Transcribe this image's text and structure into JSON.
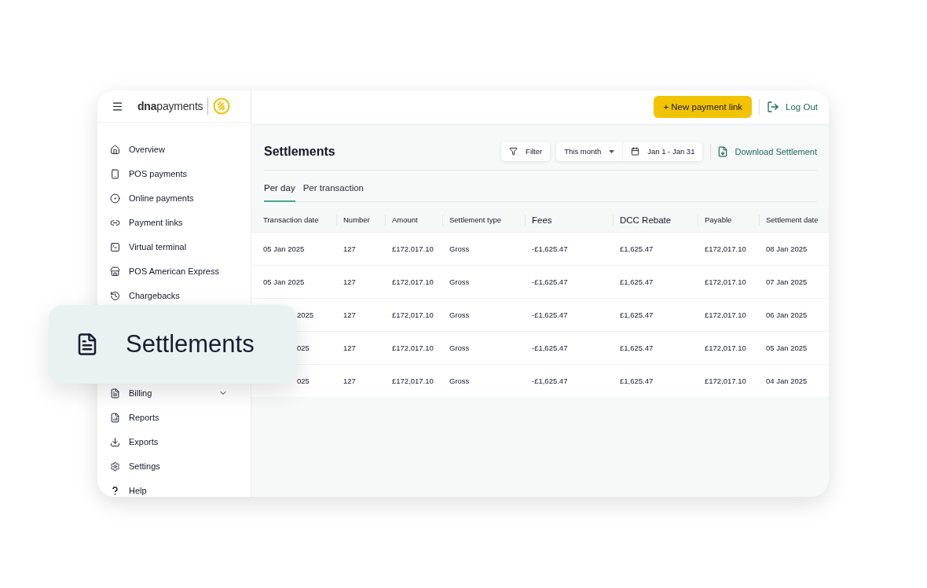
{
  "brand": {
    "name_bold": "dna",
    "name_light": "payments"
  },
  "sidebar": {
    "nav_top": [
      {
        "label": "Overview"
      },
      {
        "label": "POS payments"
      },
      {
        "label": "Online payments"
      },
      {
        "label": "Payment links"
      },
      {
        "label": "Virtual terminal"
      },
      {
        "label": "POS American Express"
      },
      {
        "label": "Chargebacks"
      }
    ],
    "nav_bottom": [
      {
        "label": "Billing",
        "expandable": true
      },
      {
        "label": "Reports",
        "expandable": false
      },
      {
        "label": "Exports",
        "expandable": false
      },
      {
        "label": "Settings",
        "expandable": false
      },
      {
        "label": "Help",
        "expandable": false
      }
    ]
  },
  "topbar": {
    "new_link_button": "+ New payment link",
    "logout": "Log Out"
  },
  "page": {
    "title": "Settlements",
    "filter": "Filter",
    "period": "This month",
    "date_range": "Jan 1 - Jan 31",
    "download": "Download Settlement"
  },
  "tabs": [
    {
      "label": "Per day",
      "selected": true
    },
    {
      "label": "Per transaction",
      "selected": false
    }
  ],
  "table": {
    "columns": [
      {
        "label": "Transaction date",
        "large": false
      },
      {
        "label": "Number",
        "large": false
      },
      {
        "label": "Amount",
        "large": false
      },
      {
        "label": "Settlement type",
        "large": false
      },
      {
        "label": "Fees",
        "large": true
      },
      {
        "label": "DCC Rebate",
        "large": true
      },
      {
        "label": "Payable",
        "large": false
      },
      {
        "label": "Settlement date",
        "large": false
      }
    ],
    "rows": [
      {
        "first_cell_covered": false,
        "cells": [
          "05 Jan 2025",
          "127",
          "£172,017.10",
          "Gross",
          "-£1,625.47",
          "£1,625.47",
          "£172,017.10",
          "08 Jan 2025"
        ]
      },
      {
        "first_cell_covered": false,
        "cells": [
          "05 Jan 2025",
          "127",
          "£172,017.10",
          "Gross",
          "-£1,625.47",
          "£1,625.47",
          "£172,017.10",
          "07 Jan 2025"
        ]
      },
      {
        "first_cell_covered": true,
        "cells": [
          "2025",
          "127",
          "£172,017.10",
          "Gross",
          "-£1,625.47",
          "£1,625.47",
          "£172,017.10",
          "06 Jan 2025"
        ]
      },
      {
        "first_cell_covered": true,
        "cells": [
          "025",
          "127",
          "£172,017.10",
          "Gross",
          "-£1,625.47",
          "£1,625.47",
          "£172,017.10",
          "05 Jan 2025"
        ]
      },
      {
        "first_cell_covered": true,
        "cells": [
          "025",
          "127",
          "£172,017.10",
          "Gross",
          "-£1,625.47",
          "£1,625.47",
          "£172,017.10",
          "04 Jan 2025"
        ]
      }
    ]
  },
  "callout": {
    "label": "Settlements"
  }
}
